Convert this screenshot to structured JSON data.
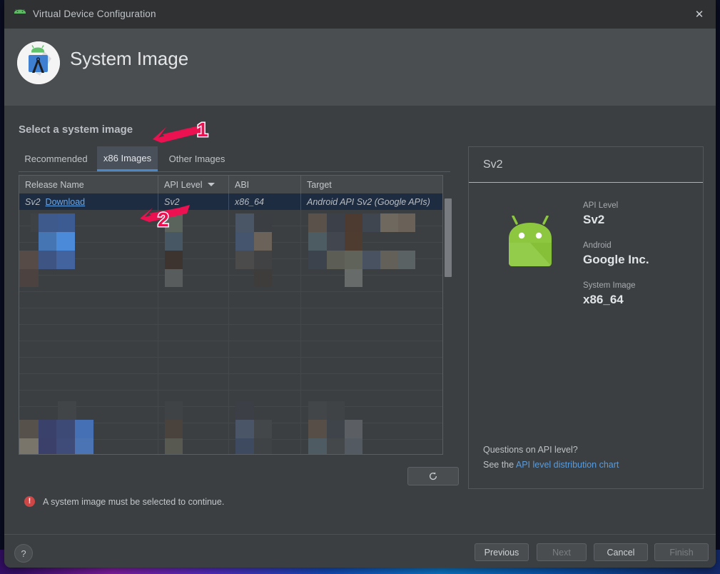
{
  "window": {
    "titlebar": {
      "title": "Virtual Device Configuration",
      "icon": "android-head-icon",
      "close_label": "✕"
    },
    "header": {
      "title": "System Image",
      "logo": "android-studio-avd-icon"
    }
  },
  "main": {
    "section_title": "Select a system image",
    "tabs": [
      {
        "label": "Recommended",
        "selected": false
      },
      {
        "label": "x86 Images",
        "selected": true
      },
      {
        "label": "Other Images",
        "selected": false
      }
    ],
    "table": {
      "columns": [
        "Release Name",
        "API Level",
        "ABI",
        "Target"
      ],
      "sorted_column": "API Level",
      "sort_icon": "chevron-down-icon",
      "selected_row": {
        "release_name": "Sv2",
        "download_label": "Download",
        "api_level": "Sv2",
        "abi": "x86_64",
        "target": "Android API Sv2 (Google APIs)"
      }
    },
    "refresh_button": {
      "icon": "refresh-icon",
      "label": ""
    },
    "error": {
      "icon": "error-icon",
      "glyph": "!",
      "text": "A system image must be selected to continue.",
      "color": "#cf4646"
    }
  },
  "details_panel": {
    "title": "Sv2",
    "image_icon": "android-robot-icon",
    "fields": [
      {
        "label": "API Level",
        "value": "Sv2"
      },
      {
        "label": "Android",
        "value": "Google Inc."
      },
      {
        "label": "System Image",
        "value": "x86_64"
      }
    ],
    "footer": {
      "question": "Questions on API level?",
      "see_prefix": "See the ",
      "link_label": "API level distribution chart"
    }
  },
  "footer": {
    "help_label": "?",
    "buttons": [
      {
        "label": "Previous",
        "disabled": false
      },
      {
        "label": "Next",
        "disabled": true
      },
      {
        "label": "Cancel",
        "disabled": false
      },
      {
        "label": "Finish",
        "disabled": true
      }
    ]
  },
  "annotations": [
    {
      "number": "1",
      "target": "x86-images-tab"
    },
    {
      "number": "2",
      "target": "download-link"
    }
  ],
  "colors": {
    "accent_blue": "#4a88c7",
    "link_blue": "#5b9bd9",
    "annotation_red": "#ec1150",
    "android_green": "#8fc954",
    "error_red": "#cf4646"
  }
}
